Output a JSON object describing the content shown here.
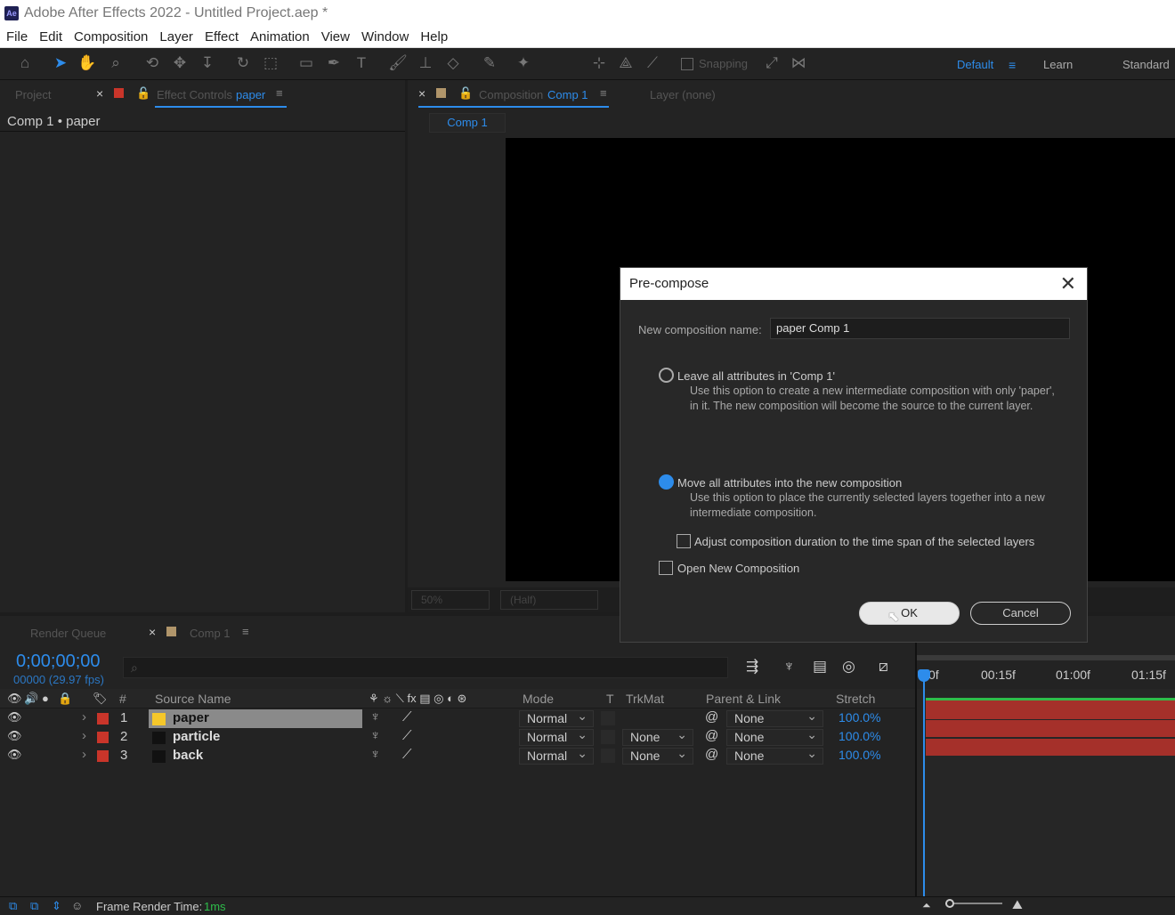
{
  "app": {
    "logo_text": "Ae",
    "title": "Adobe After Effects 2022 - Untitled Project.aep *"
  },
  "menu": [
    "File",
    "Edit",
    "Composition",
    "Layer",
    "Effect",
    "Animation",
    "View",
    "Window",
    "Help"
  ],
  "toolbar": {
    "snapping_label": "Snapping",
    "workspaces": [
      "Default",
      "Learn",
      "Standard"
    ]
  },
  "left_panel": {
    "tab_project": "Project",
    "tab_effect_controls": "Effect Controls",
    "tab_effect_controls_layer": "paper",
    "subtitle": "Comp 1 • paper"
  },
  "viewer": {
    "tab_composition": "Composition",
    "tab_composition_name": "Comp 1",
    "tab_layer": "Layer (none)",
    "comp_tab": "Comp 1",
    "zoom": "50%",
    "resolution": "(Half)"
  },
  "timeline": {
    "tab_render_queue": "Render Queue",
    "tab_comp": "Comp 1",
    "timecode": "0;00;00;00",
    "fps": "00000 (29.97 fps)",
    "search_icon": "⌕",
    "columns": {
      "num": "#",
      "source_name": "Source Name",
      "mode": "Mode",
      "t": "T",
      "trkmat": "TrkMat",
      "parent": "Parent & Link",
      "stretch": "Stretch"
    },
    "ruler": [
      "0f",
      "00:15f",
      "01:00f",
      "01:15f"
    ],
    "layers": [
      {
        "num": "1",
        "name": "paper",
        "mode": "Normal",
        "trkmat": "",
        "parent": "None",
        "stretch": "100.0%"
      },
      {
        "num": "2",
        "name": "particle",
        "mode": "Normal",
        "trkmat": "None",
        "parent": "None",
        "stretch": "100.0%"
      },
      {
        "num": "3",
        "name": "back",
        "mode": "Normal",
        "trkmat": "None",
        "parent": "None",
        "stretch": "100.0%"
      }
    ]
  },
  "status": {
    "label": "Frame Render Time:",
    "value": "1ms"
  },
  "dialog": {
    "title": "Pre-compose",
    "name_label": "New composition name:",
    "name_value": "paper Comp 1",
    "option1_title": "Leave all attributes in 'Comp 1'",
    "option1_desc": "Use this option to create a new intermediate composition with only 'paper', in it. The new composition will become the source to the current layer.",
    "option2_title": "Move all attributes into the new composition",
    "option2_desc": "Use this option to place the currently selected layers together into a new intermediate composition.",
    "adjust_label": "Adjust composition duration to the time span of the selected layers",
    "open_label": "Open New Composition",
    "ok_label": "OK",
    "cancel_label": "Cancel"
  }
}
